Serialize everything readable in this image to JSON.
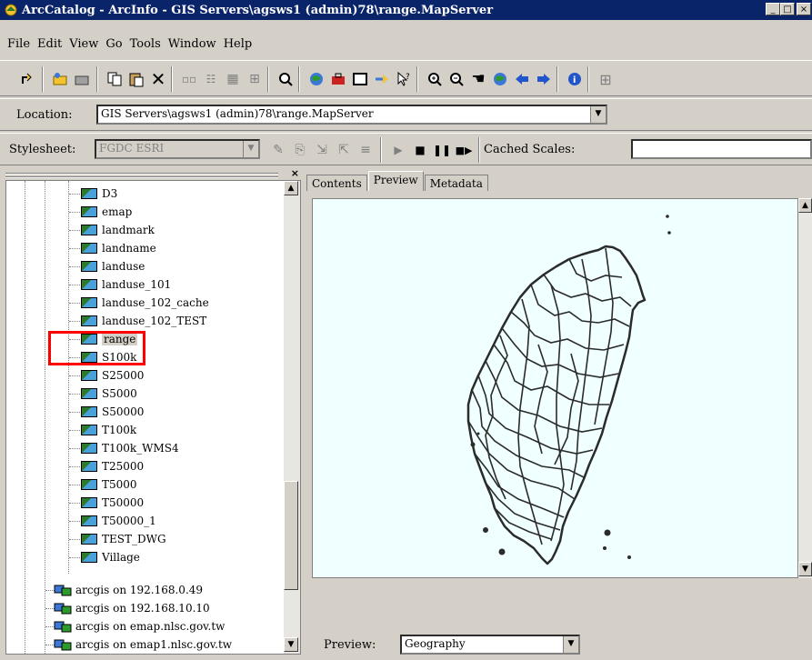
{
  "window": {
    "title": "ArcCatalog - ArcInfo - GIS Servers\\agsws1 (admin)78\\range.MapServer",
    "min_label": "_",
    "max_label": "□",
    "close_label": "×"
  },
  "menu": [
    "File",
    "Edit",
    "View",
    "Go",
    "Tools",
    "Window",
    "Help"
  ],
  "location": {
    "label": "Location:",
    "value": "GIS Servers\\agsws1 (admin)78\\range.MapServer"
  },
  "stylesheet": {
    "label": "Stylesheet:",
    "value": "FGDC ESRI",
    "cached_label": "Cached Scales:",
    "cached_value": ""
  },
  "tree": {
    "close_label": "×",
    "layers": [
      "D3",
      "emap",
      "landmark",
      "landname",
      "landuse",
      "landuse_101",
      "landuse_102_cache",
      "landuse_102_TEST",
      "range",
      "S100k",
      "S25000",
      "S5000",
      "S50000",
      "T100k",
      "T100k_WMS4",
      "T25000",
      "T5000",
      "T50000",
      "T50000_1",
      "TEST_DWG",
      "Village"
    ],
    "selected": "range",
    "servers": [
      "arcgis on 192.168.0.49",
      "arcgis on 192.168.10.10",
      "arcgis on emap.nlsc.gov.tw",
      "arcgis on emap1.nlsc.gov.tw"
    ]
  },
  "tabs": [
    "Contents",
    "Preview",
    "Metadata"
  ],
  "active_tab": "Preview",
  "preview": {
    "label": "Preview:",
    "value": "Geography"
  },
  "colors": {
    "title_bar": "#0a246a",
    "highlight_box": "#ff0000",
    "map_background": "#f0ffff",
    "map_lines": "#2b2b2b"
  }
}
